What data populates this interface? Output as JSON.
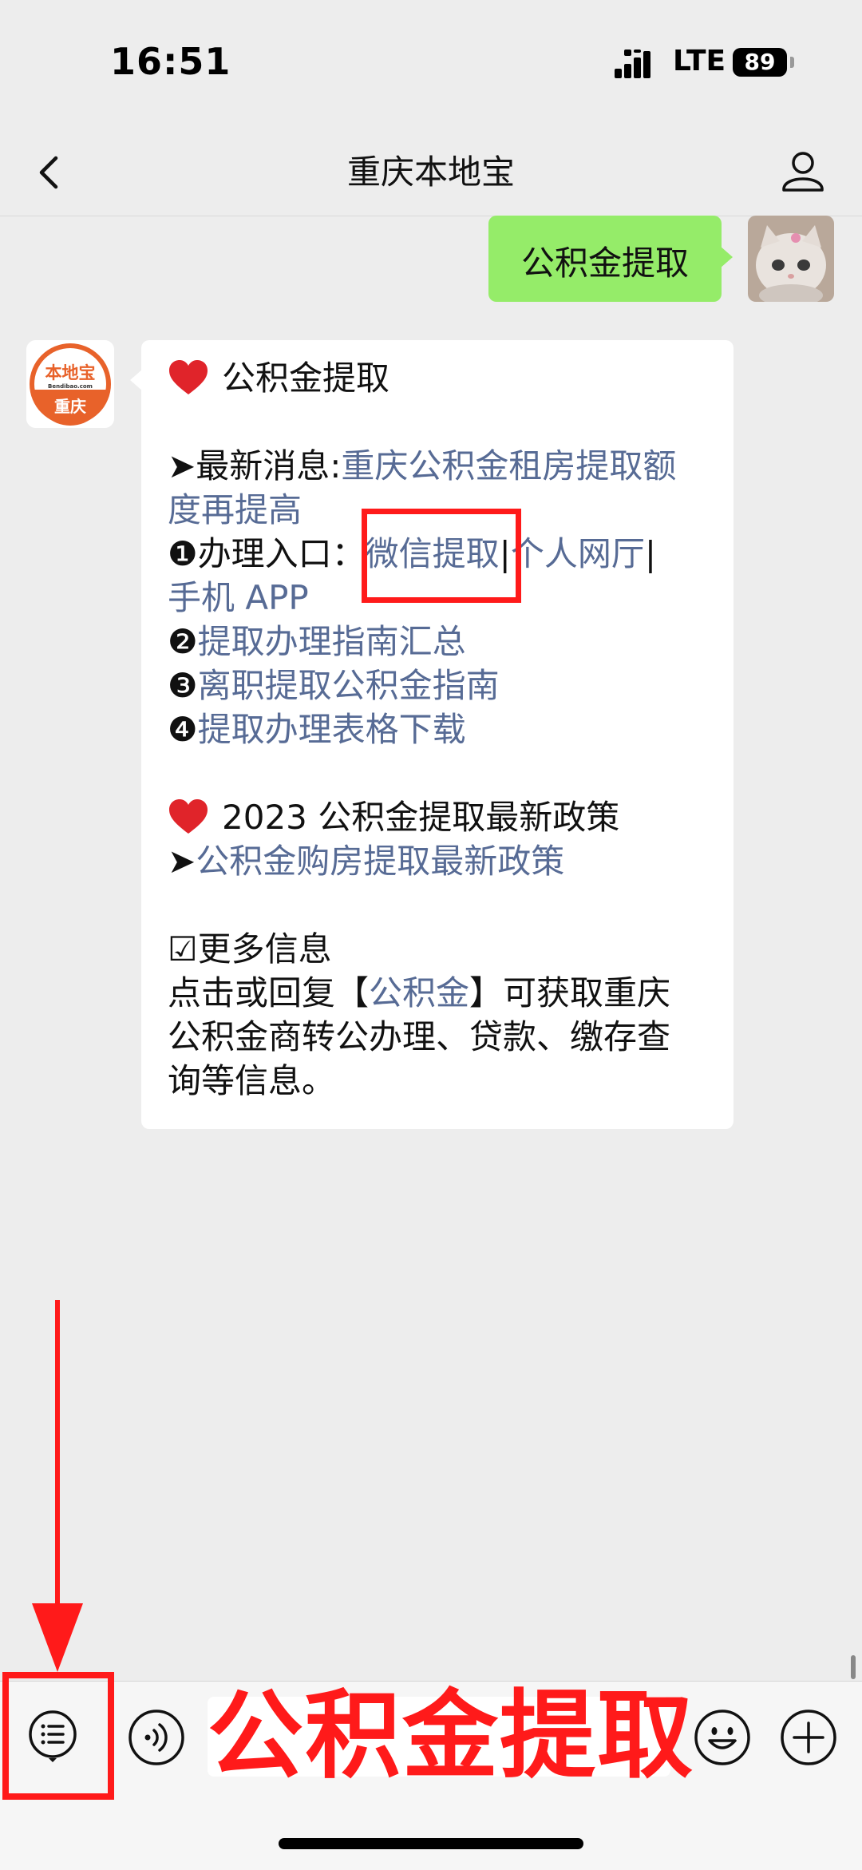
{
  "status_bar": {
    "time": "16:51",
    "network": "LTE",
    "battery": "89"
  },
  "nav": {
    "title": "重庆本地宝"
  },
  "outgoing_message": {
    "text": "公积金提取"
  },
  "bot_avatar": {
    "brand": "本地宝",
    "domain": "Bendibao.com",
    "city": "重庆"
  },
  "incoming_message": {
    "heading1": "公积金提取",
    "news_prefix": "➤最新消息:",
    "news_link_line1": "重庆公积金租房提取额",
    "news_link_line2": "度再提高",
    "item1_prefix": "❶办理入口：",
    "item1_link_wechat": "微信提取",
    "item1_sep": "|",
    "item1_link_web": "个人网厅",
    "item1_link_app": "手机 APP",
    "item2_prefix": "❷",
    "item2_link": "提取办理指南汇总",
    "item3_prefix": "❸",
    "item3_link": "离职提取公积金指南",
    "item4_prefix": "❹",
    "item4_link": "提取办理表格下载",
    "heading2": "2023 公积金提取最新政策",
    "policy_prefix": "➤",
    "policy_link": "公积金购房提取最新政策",
    "more_info": "☑更多信息",
    "footer_pre": "点击或回复【",
    "footer_link": "公积金",
    "footer_post": "】可获取重庆",
    "footer_line2": "公积金商转公办理、贷款、缴存查",
    "footer_line3": "询等信息。"
  },
  "input_bar": {
    "input_value": "公积金提取"
  },
  "colors": {
    "annotation_red": "#ff1a1a",
    "link_blue": "#576b95",
    "outgoing_bubble": "#95ec69",
    "background": "#ededed"
  }
}
